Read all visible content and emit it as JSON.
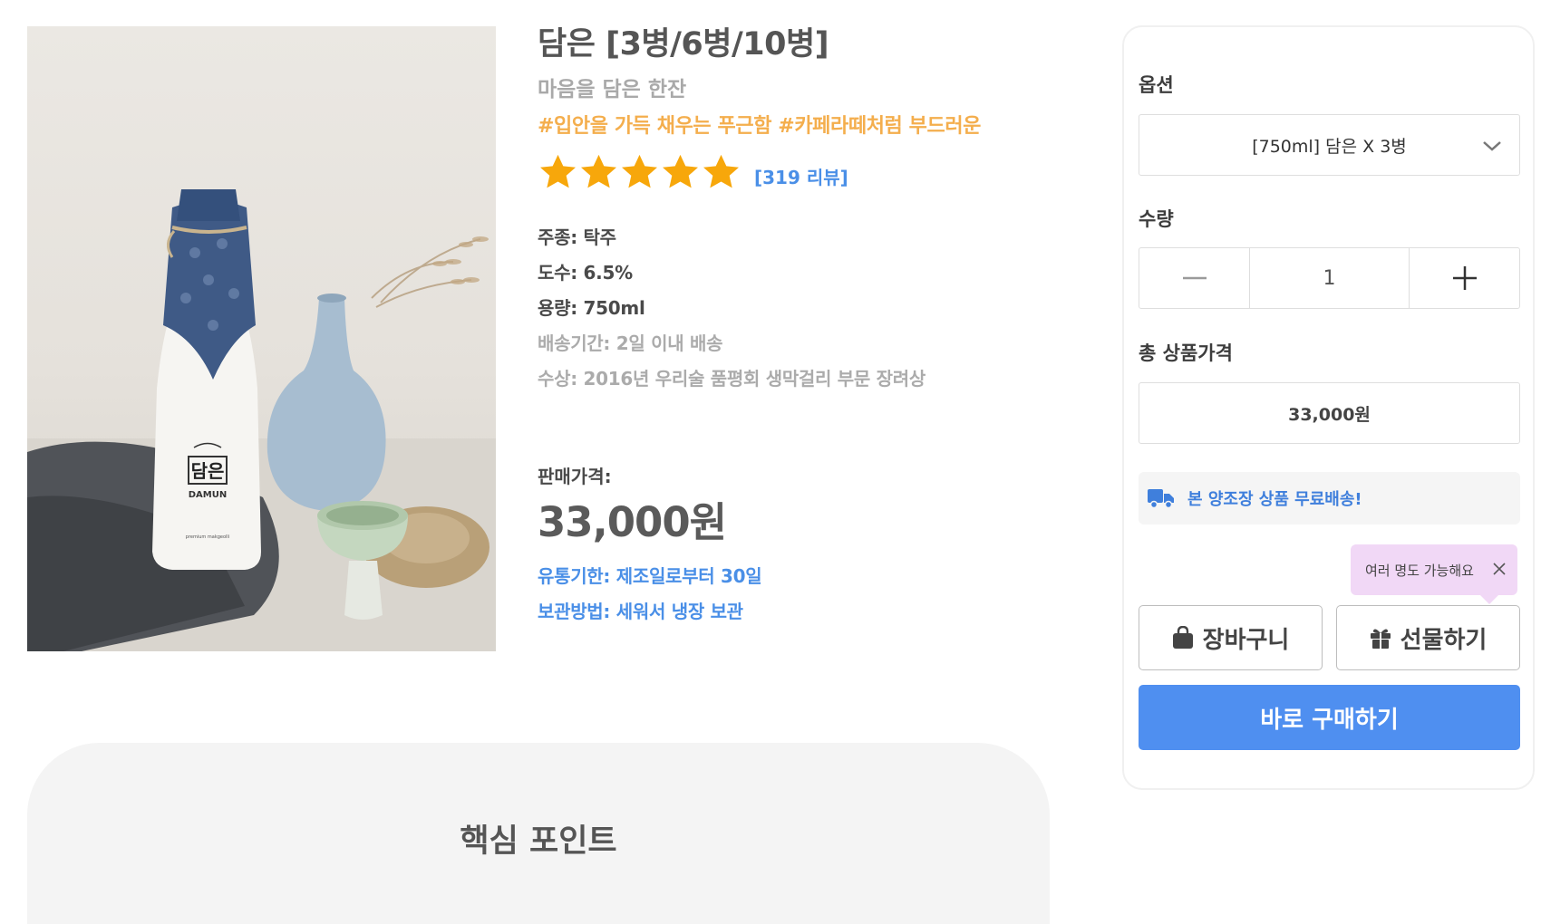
{
  "product": {
    "image_alt": "담은 막걸리 병과 잔",
    "label_ko": "담은",
    "label_en": "DAMUN",
    "label_small": "premium makgeolli",
    "title": "담은 [3병/6병/10병]",
    "subtitle": "마음을 담은 한잔",
    "hashtags": "#입안을 가득 채우는 푸근함 #카페라떼처럼 부드러운",
    "rating_stars": 5,
    "review_count": "[319 리뷰]",
    "specs": [
      {
        "text": "주종: 탁주"
      },
      {
        "text": "도수: 6.5%"
      },
      {
        "text": "용량: 750ml"
      },
      {
        "text": "배송기간: 2일 이내 배송"
      },
      {
        "text": "수상: 2016년 우리술 품평회 생막걸리 부문 장려상"
      }
    ],
    "price_label": "판매가격:",
    "price": "33,000원",
    "expiry": "유통기한: 제조일로부터 30일",
    "storage": "보관방법: 세워서 냉장 보관"
  },
  "key_points": {
    "title": "핵심 포인트"
  },
  "order": {
    "option_label": "옵션",
    "option_value": "[750ml] 담은 X 3병",
    "quantity_label": "수량",
    "quantity_value": "1",
    "total_label": "총 상품가격",
    "total_value": "33,000원",
    "shipping_note": "본 양조장 상품 무료배송!",
    "tooltip": "여러 명도 가능해요",
    "cart_button": "장바구니",
    "gift_button": "선물하기",
    "buy_button": "바로 구매하기"
  },
  "colors": {
    "accent_blue": "#4f8ff0",
    "link_blue": "#4a8fe7",
    "hashtag_orange": "#f4ae4d",
    "star_orange": "#f7a70b",
    "tooltip_pink": "#f1d8f6"
  },
  "icons": {
    "star": "star-icon",
    "chevron": "chevron-down-icon",
    "minus": "minus-icon",
    "plus": "plus-icon",
    "truck": "truck-icon",
    "close": "close-icon",
    "bag": "shopping-bag-icon",
    "gift": "gift-icon"
  }
}
